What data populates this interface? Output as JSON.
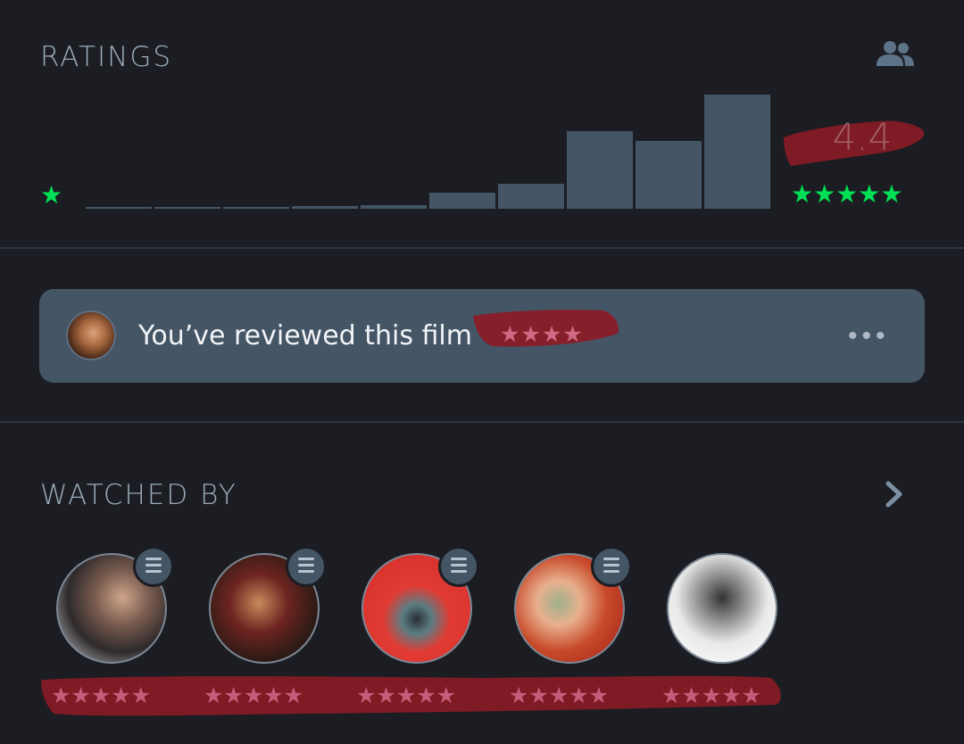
{
  "ratings": {
    "title": "RATINGS",
    "average": "4.4",
    "low_label": "★",
    "high_label": "★★★★★",
    "distribution": [
      0.01,
      0.01,
      0.01,
      0.02,
      0.03,
      0.14,
      0.22,
      0.68,
      0.59,
      1.0
    ],
    "bar_color": "#445566",
    "star_color": "#00e054",
    "icon": "friends-icon"
  },
  "review": {
    "text": "You’ve reviewed this film",
    "rating_stars": "★★★★",
    "more_icon": "more-dots-icon",
    "more": "•••"
  },
  "watched_by": {
    "title": "WATCHED BY",
    "icon": "chevron-right-icon",
    "users": [
      {
        "has_list_badge": true,
        "stars": "★★★★★"
      },
      {
        "has_list_badge": true,
        "stars": "★★★★★"
      },
      {
        "has_list_badge": true,
        "stars": "★★★★★"
      },
      {
        "has_list_badge": true,
        "stars": "★★★★★"
      },
      {
        "has_list_badge": false,
        "stars": "★★★★★"
      }
    ]
  },
  "colors": {
    "background": "#1b1d22",
    "card": "#445566",
    "scribble": "#8b1c26"
  }
}
